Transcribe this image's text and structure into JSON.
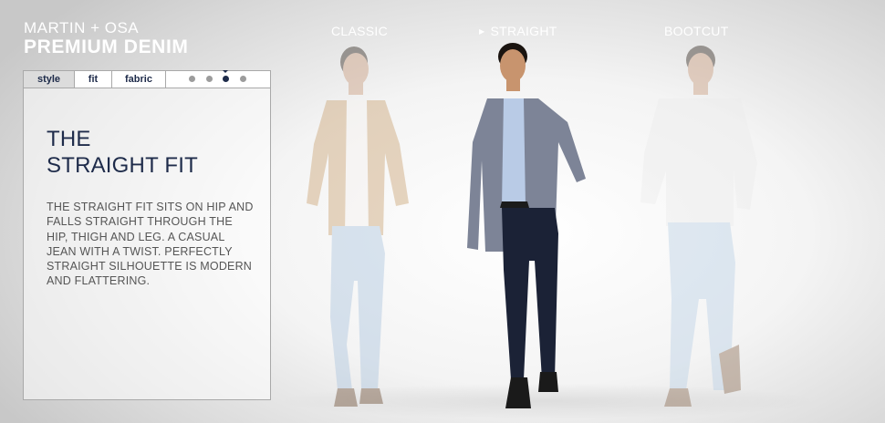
{
  "brand": {
    "top": "MARTIN + OSA",
    "main": "PREMIUM DENIM"
  },
  "fits": [
    {
      "label": "CLASSIC"
    },
    {
      "label": "STRAIGHT",
      "selected": true
    },
    {
      "label": "BOOTCUT"
    }
  ],
  "tabs": {
    "style": "style",
    "fit": "fit",
    "fabric": "fabric"
  },
  "pager": {
    "total": 4,
    "active_index": 2
  },
  "content": {
    "heading_line1": "THE",
    "heading_line2": "STRAIGHT FIT",
    "description": "THE STRAIGHT FIT SITS ON HIP AND FALLS STRAIGHT THROUGH THE HIP, THIGH AND LEG. A CASUAL JEAN WITH A TWIST. PERFECTLY STRAIGHT SILHOUETTE IS MODERN AND FLATTERING."
  },
  "colors": {
    "brand_navy": "#1e2b4a",
    "tab_active_bg": "#dcdcdc",
    "dot_inactive": "#9c9c9c"
  }
}
